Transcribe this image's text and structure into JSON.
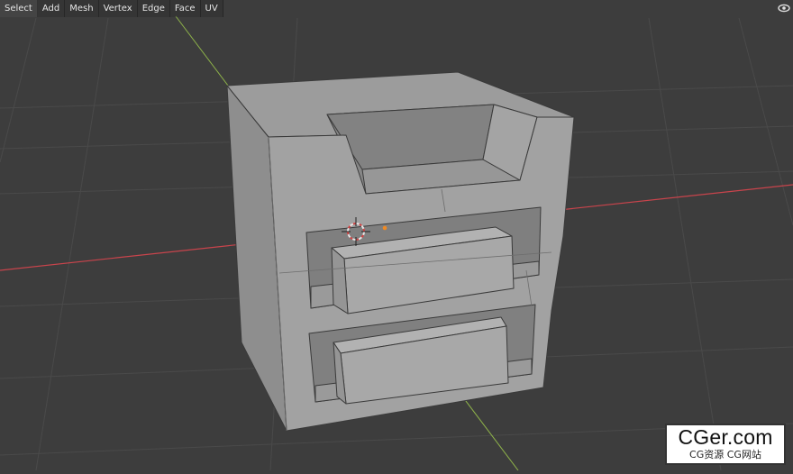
{
  "header": {
    "menu": [
      {
        "label": "Select"
      },
      {
        "label": "Add"
      },
      {
        "label": "Mesh"
      },
      {
        "label": "Vertex"
      },
      {
        "label": "Edge"
      },
      {
        "label": "Face"
      },
      {
        "label": "UV"
      }
    ],
    "overlay_icon": "eye-icon"
  },
  "viewport": {
    "background_color": "#3d3d3d",
    "grid_color": "#4a4a4a",
    "x_axis_color": "#c9444c",
    "y_axis_color": "#8fb44a",
    "object": "cube with drawer-like cutouts",
    "cursor_icon": "3d-cursor-icon",
    "origin_color": "#f08a24"
  },
  "watermark": {
    "title": "CGer.com",
    "subtitle": "CG资源 CG网站"
  }
}
